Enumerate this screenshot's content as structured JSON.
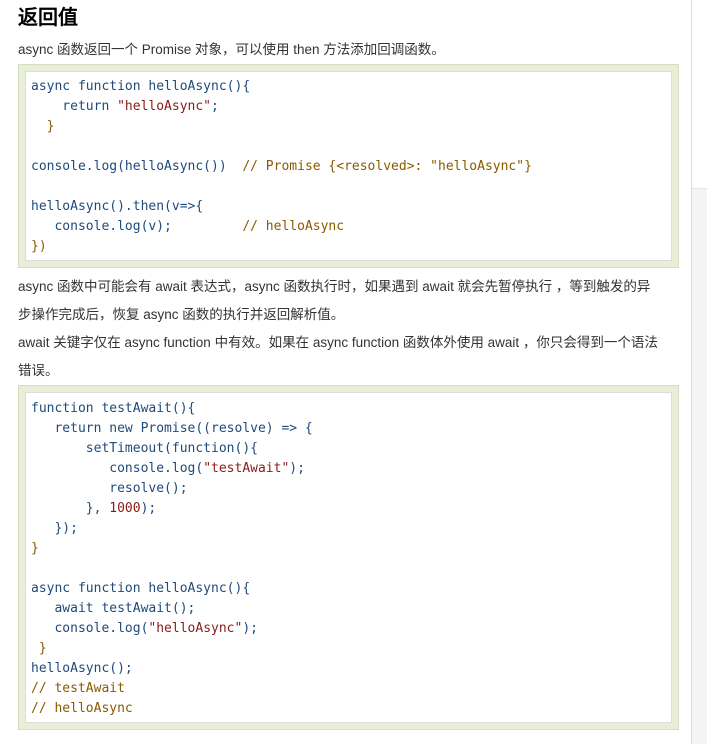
{
  "section": {
    "title": "返回值",
    "intro": "async 函数返回一个 Promise 对象，可以使用 then 方法添加回调函数。",
    "para_await_1": "async 函数中可能会有 await 表达式，async 函数执行时，如果遇到 await 就会先暂停执行 ，等到触发的异",
    "para_await_2": "步操作完成后，恢复 async 函数的执行并返回解析值。",
    "para_await_3": "await 关键字仅在 async function 中有效。如果在 async function 函数体外使用 await ，你只会得到一个语法",
    "para_await_4": "错误。"
  },
  "code_block_1": {
    "lines": [
      "async function helloAsync(){",
      "    return \"helloAsync\";",
      "  }",
      "",
      "console.log(helloAsync())  // Promise {<resolved>: \"helloAsync\"}",
      "",
      "helloAsync().then(v=>{",
      "   console.log(v);         // helloAsync",
      "})"
    ]
  },
  "code_block_2": {
    "lines": [
      "function testAwait(){",
      "   return new Promise((resolve) => {",
      "       setTimeout(function(){",
      "          console.log(\"testAwait\");",
      "          resolve();",
      "       }, 1000);",
      "   });",
      "}",
      "",
      "async function helloAsync(){",
      "   await testAwait();",
      "   console.log(\"helloAsync\");",
      " }",
      "helloAsync();",
      "// testAwait",
      "// helloAsync"
    ]
  },
  "colors": {
    "keyword": "#1f4a7a",
    "string": "#8b1a1a",
    "comment": "#8a5a00",
    "code_frame": "#e8eed7"
  }
}
